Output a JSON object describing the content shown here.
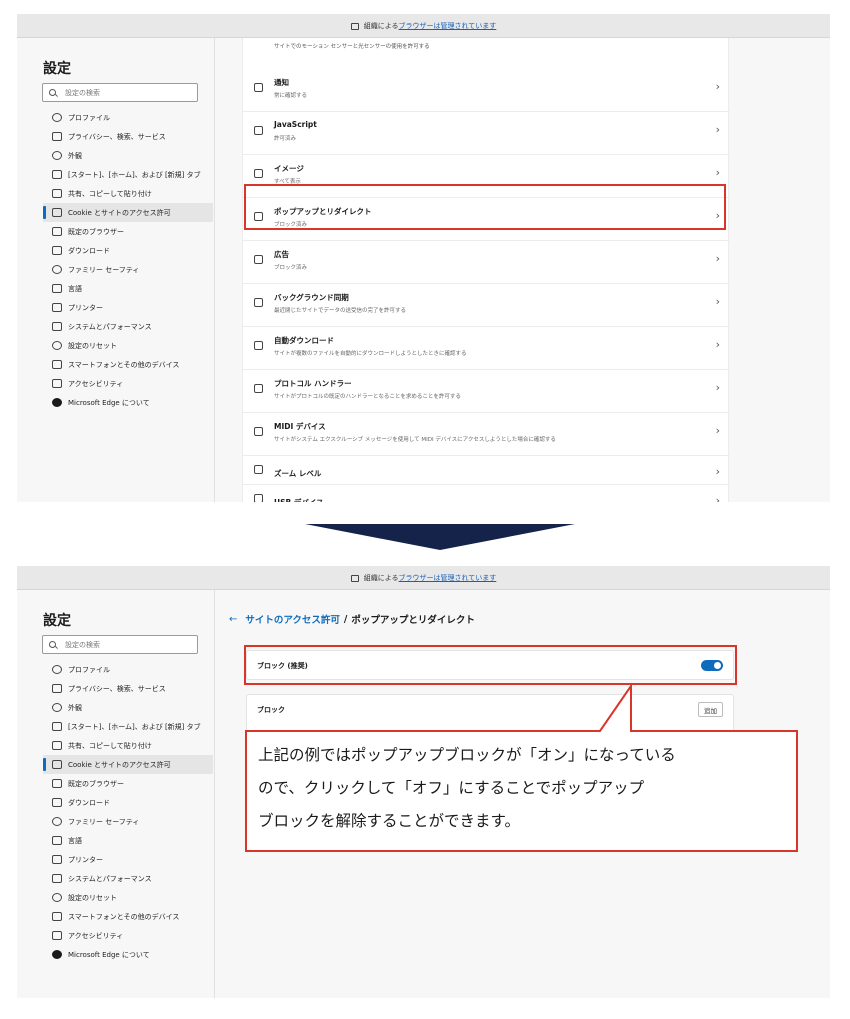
{
  "banner": {
    "prefix": "組織による",
    "link": "ブラウザーは管理されています"
  },
  "sidebar": {
    "title": "設定",
    "search_placeholder": "設定の検索",
    "items": [
      {
        "label": "プロファイル",
        "icon": "profile-icon"
      },
      {
        "label": "プライバシー、検索、サービス",
        "icon": "lock-icon"
      },
      {
        "label": "外観",
        "icon": "appearance-icon"
      },
      {
        "label": "[スタート]、[ホーム]、および [新規] タブ",
        "icon": "home-tab-icon"
      },
      {
        "label": "共有、コピーして貼り付け",
        "icon": "share-icon"
      },
      {
        "label": "Cookie とサイトのアクセス許可",
        "icon": "cookie-icon",
        "active": true
      },
      {
        "label": "既定のブラウザー",
        "icon": "browser-icon"
      },
      {
        "label": "ダウンロード",
        "icon": "download-icon"
      },
      {
        "label": "ファミリー セーフティ",
        "icon": "family-icon"
      },
      {
        "label": "言語",
        "icon": "language-icon"
      },
      {
        "label": "プリンター",
        "icon": "printer-icon"
      },
      {
        "label": "システムとパフォーマンス",
        "icon": "system-icon"
      },
      {
        "label": "設定のリセット",
        "icon": "reset-icon"
      },
      {
        "label": "スマートフォンとその他のデバイス",
        "icon": "phone-icon"
      },
      {
        "label": "アクセシビリティ",
        "icon": "accessibility-icon"
      },
      {
        "label": "Microsoft Edge について",
        "icon": "edge-icon"
      }
    ]
  },
  "permissions": {
    "top_desc": "サイトでのモーション センサーと光センサーの使用を許可する",
    "rows": [
      {
        "title": "通知",
        "desc": "常に確認する",
        "icon": "bell-icon"
      },
      {
        "title": "JavaScript",
        "desc": "許可済み",
        "icon": "javascript-icon"
      },
      {
        "title": "イメージ",
        "desc": "すべて表示",
        "icon": "image-icon"
      },
      {
        "title": "ポップアップとリダイレクト",
        "desc": "ブロック済み",
        "icon": "popup-icon"
      },
      {
        "title": "広告",
        "desc": "ブロック済み",
        "icon": "ads-icon"
      },
      {
        "title": "バックグラウンド同期",
        "desc": "最近閉じたサイトでデータの送受信の完了を許可する",
        "icon": "sync-icon"
      },
      {
        "title": "自動ダウンロード",
        "desc": "サイトが複数のファイルを自動的にダウンロードしようとしたときに確認する",
        "icon": "auto-download-icon"
      },
      {
        "title": "プロトコル ハンドラー",
        "desc": "サイトがプロトコルの既定のハンドラーとなることを求めることを許可する",
        "icon": "protocol-icon"
      },
      {
        "title": "MIDI デバイス",
        "desc": "サイトがシステム エクスクルーシブ メッセージを使用して MIDI デバイスにアクセスしようとした場合に確認する",
        "icon": "midi-icon"
      },
      {
        "title": "ズーム レベル",
        "desc": "",
        "icon": "zoom-icon"
      },
      {
        "title": "USB デバイス",
        "desc": "",
        "icon": "usb-icon"
      }
    ]
  },
  "popup_page": {
    "breadcrumb_parent": "サイトのアクセス許可",
    "breadcrumb_sep": "/",
    "breadcrumb_current": "ポップアップとリダイレクト",
    "block_label": "ブロック (推奨)",
    "block_enabled": true,
    "block_list_label": "ブロック",
    "add_button": "追加"
  },
  "callout": {
    "line1": "上記の例ではポップアップブロックが「オン」になっている",
    "line2": "ので、クリックして「オフ」にすることでポップアップ",
    "line3": "ブロックを解除することができます。"
  },
  "colors": {
    "highlight": "#d9362b",
    "accent": "#0f6cbd",
    "arrow": "#15224a"
  }
}
